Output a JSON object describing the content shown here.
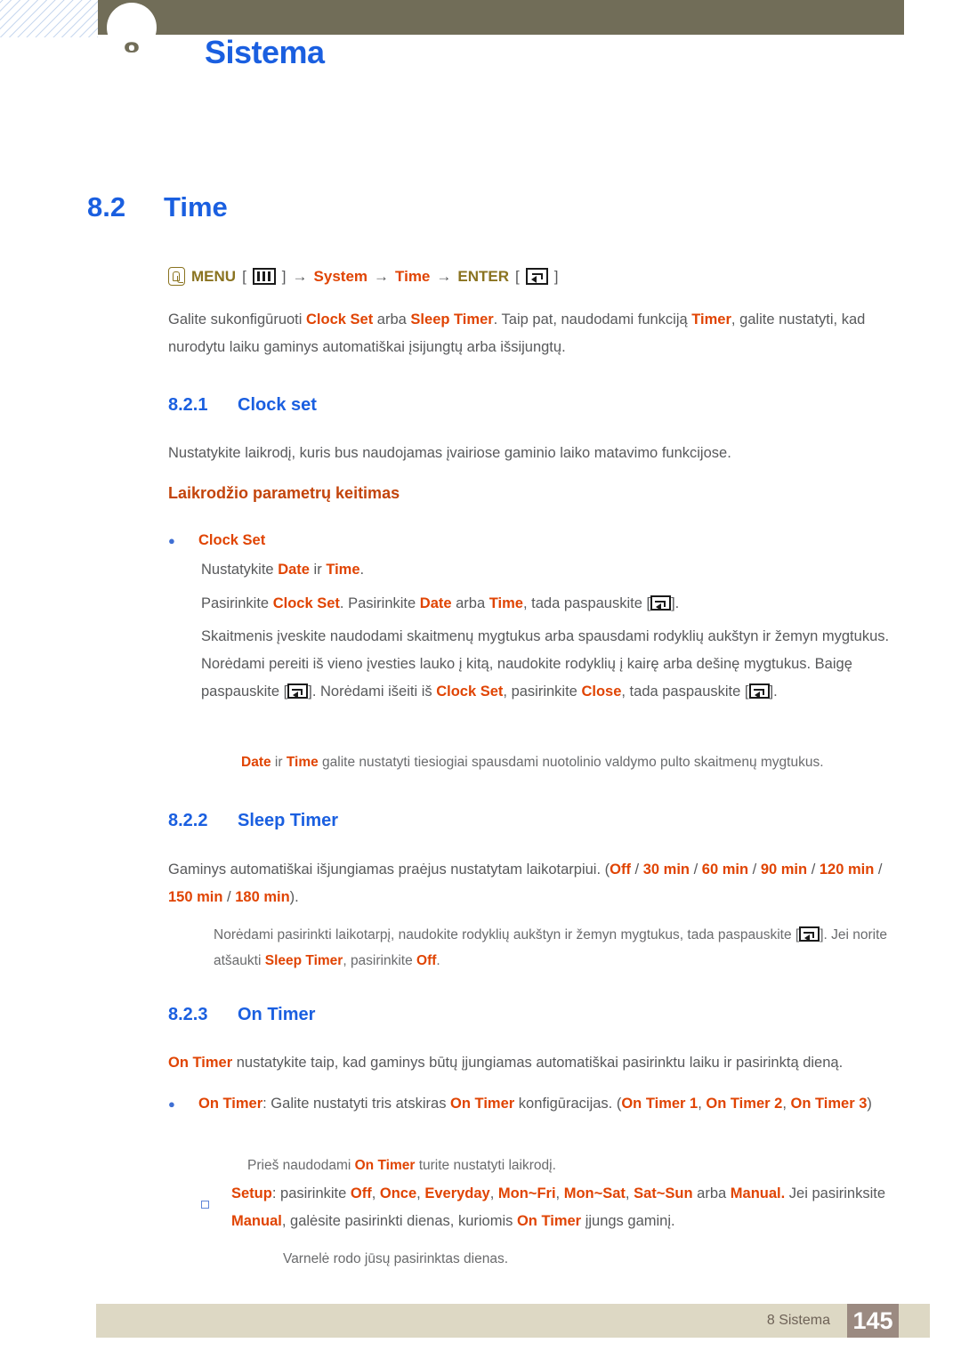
{
  "header": {
    "chapter_number": "8",
    "chapter_title": "Sistema"
  },
  "section": {
    "number": "8.2",
    "title": "Time"
  },
  "menu_path": {
    "hand_icon": "hand-press-icon",
    "menu_label": "MENU",
    "menu_icon": "menu-bars-icon",
    "arrow1": "→",
    "system_label": "System",
    "arrow2": "→",
    "time_label": "Time",
    "arrow3": "→",
    "enter_label": "ENTER",
    "enter_icon": "enter-key-icon",
    "bracket_open": "[",
    "bracket_close": "]"
  },
  "intro": {
    "p1_a": "Galite sukonfigūruoti ",
    "p1_b": "Clock Set",
    "p1_c": " arba ",
    "p1_d": "Sleep Timer",
    "p1_e": ". Taip pat, naudodami funkciją ",
    "p1_f": "Timer",
    "p1_g": ", galite nustatyti, kad nurodytu laiku gaminys automatiškai įsijungtų arba išsijungtų."
  },
  "clock_set": {
    "number": "8.2.1",
    "title": "Clock set",
    "intro": "Nustatykite laikrodį, kuris bus naudojamas įvairiose gaminio laiko matavimo funkcijose.",
    "sub_head": "Laikrodžio parametrų keitimas",
    "bullet_label": "Clock Set",
    "line1_a": "Nustatykite ",
    "line1_b": "Date",
    "line1_c": " ir ",
    "line1_d": "Time",
    "line1_e": ".",
    "line2_a": "Pasirinkite ",
    "line2_b": "Clock Set",
    "line2_c": ". Pasirinkite ",
    "line2_d": "Date",
    "line2_e": " arba ",
    "line2_f": "Time",
    "line2_g": ", tada paspauskite [",
    "line2_h": "].",
    "line3_a": "Skaitmenis įveskite naudodami skaitmenų mygtukus arba spausdami rodyklių aukštyn ir žemyn mygtukus. Norėdami pereiti iš vieno įvesties lauko į kitą, naudokite rodyklių į kairę arba dešinę mygtukus. Baigę paspauskite [",
    "line3_b": "]. Norėdami išeiti iš ",
    "line3_c": "Clock Set",
    "line3_d": ", pasirinkite ",
    "line3_e": "Close",
    "line3_f": ", tada paspauskite [",
    "line3_g": "].",
    "note_a": "Date",
    "note_b": " ir ",
    "note_c": "Time",
    "note_d": " galite nustatyti tiesiogiai spausdami nuotolinio valdymo pulto skaitmenų mygtukus."
  },
  "sleep_timer": {
    "number": "8.2.2",
    "title": "Sleep Timer",
    "desc_a": "Gaminys automatiškai išjungiamas praėjus nustatytam laikotarpiui. (",
    "options": [
      "Off",
      "30 min",
      "60 min",
      "90 min",
      "120 min",
      "150 min",
      "180 min"
    ],
    "desc_b": ").",
    "note_a": "Norėdami pasirinkti laikotarpį, naudokite rodyklių aukštyn ir žemyn mygtukus, tada paspauskite [",
    "note_b": "]. Jei norite atšaukti ",
    "note_c": "Sleep Timer",
    "note_d": ", pasirinkite ",
    "note_e": "Off",
    "note_f": "."
  },
  "on_timer": {
    "number": "8.2.3",
    "title": "On Timer",
    "desc_a": "On Timer",
    "desc_b": " nustatykite taip, kad gaminys būtų įjungiamas automatiškai pasirinktu laiku ir pasirinktą dieną.",
    "b1_a": "On Timer",
    "b1_b": ": Galite nustatyti tris atskiras ",
    "b1_c": "On Timer",
    "b1_d": " konfigūracijas. (",
    "b1_e": "On Timer 1",
    "b1_f": ", ",
    "b1_g": "On Timer 2",
    "b1_h": ", ",
    "b1_i": "On Timer 3",
    "b1_j": ")",
    "note1_a": "Prieš naudodami ",
    "note1_b": "On Timer",
    "note1_c": " turite nustatyti laikrodį.",
    "b2_a": "Setup",
    "b2_b": ": pasirinkite ",
    "b2_opts": [
      "Off",
      "Once",
      "Everyday",
      "Mon~Fri",
      "Mon~Sat",
      "Sat~Sun"
    ],
    "b2_c": " arba ",
    "b2_d": "Manual.",
    "b2_e": " Jei pasirinksite ",
    "b2_f": "Manual",
    "b2_g": ", galėsite pasirinkti dienas, kuriomis ",
    "b2_h": "On Timer",
    "b2_i": " įjungs gaminį.",
    "note2": "Varnelė rodo jūsų pasirinktas dienas."
  },
  "footer": {
    "label": "8 Sistema",
    "page_number": "145"
  },
  "colors": {
    "accent_blue": "#1a5fe0",
    "accent_orange": "#e04403",
    "olive": "#716d58",
    "footer_bar": "#ddd8c4",
    "footer_box": "#9b8a81"
  }
}
